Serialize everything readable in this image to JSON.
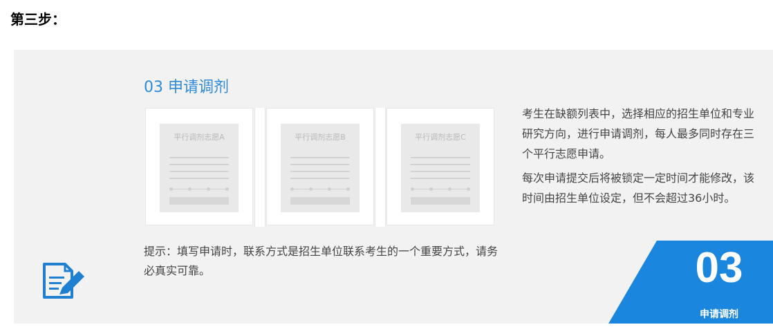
{
  "step_title": "第三步：",
  "section_title": "03 申请调剂",
  "cards": [
    {
      "label": "平行调剂志愿A"
    },
    {
      "label": "平行调剂志愿B"
    },
    {
      "label": "平行调剂志愿C"
    }
  ],
  "hint": "提示：填写申请时，联系方式是招生单位联系考生的一个重要方式，请务必真实可靠。",
  "description": {
    "paragraph1": "考生在缺额列表中，选择相应的招生单位和专业研究方向，进行申请调剂，每人最多同时存在三个平行志愿申请。",
    "paragraph2": "每次申请提交后将被锁定一定时间才能修改，该时间由招生单位设定，但不会超过36小时。"
  },
  "badge": {
    "number": "03",
    "label": "申请调剂"
  },
  "colors": {
    "accent": "#2f8ad8",
    "badge": "#1a86de",
    "panel": "#f2f2f2",
    "icon": "#1f7fd1"
  },
  "icons": {
    "form": "edit-document-icon"
  }
}
